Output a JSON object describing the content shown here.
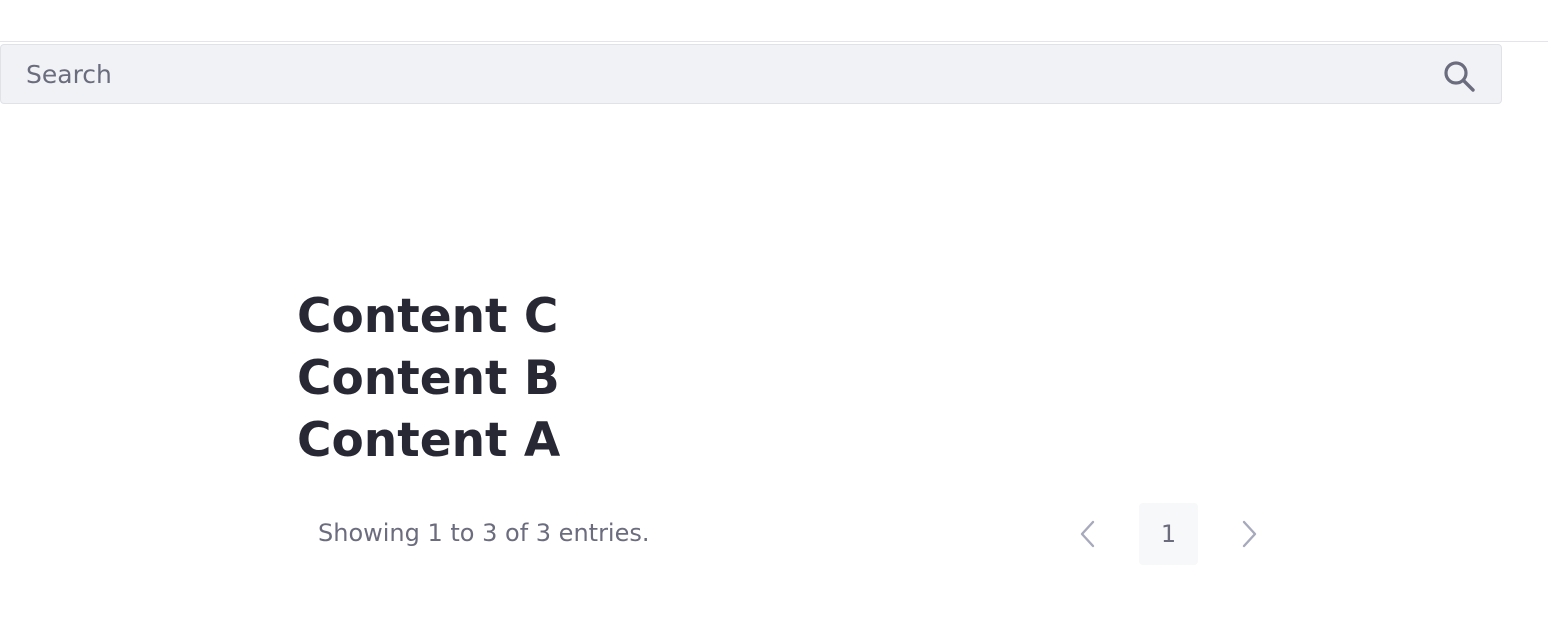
{
  "search": {
    "placeholder": "Search",
    "icon": "search-icon"
  },
  "content_list": {
    "items": [
      {
        "title": "Content C"
      },
      {
        "title": "Content B"
      },
      {
        "title": "Content A"
      }
    ]
  },
  "pagination": {
    "summary": "Showing 1 to 3 of 3 entries.",
    "current_page": "1",
    "prev_icon": "chevron-left-icon",
    "next_icon": "chevron-right-icon"
  },
  "colors": {
    "heading_text": "#272833",
    "secondary_text": "#6b6c7e",
    "search_background": "#f1f2f5",
    "disabled_chevron": "#a7a9bc"
  }
}
